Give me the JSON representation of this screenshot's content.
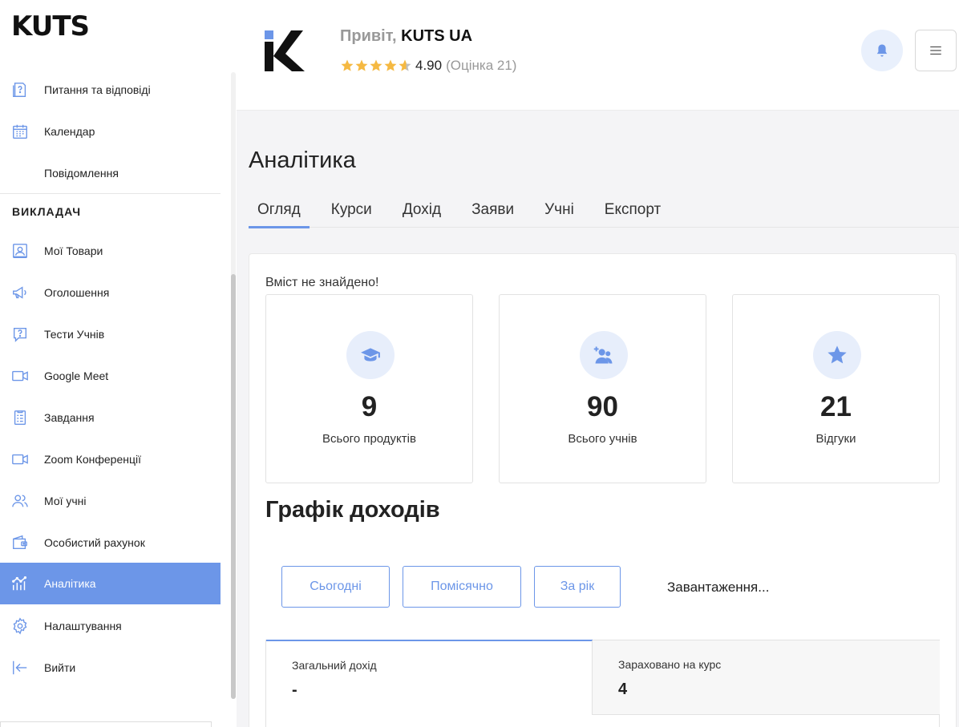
{
  "app": {
    "logo_text": "KUTS"
  },
  "sidebar": {
    "top_items": [
      {
        "label": "Питання та відповіді",
        "icon": "qa-book-icon"
      },
      {
        "label": "Календар",
        "icon": "calendar-icon"
      },
      {
        "label": "Повідомлення",
        "icon": ""
      }
    ],
    "section_title": "ВИКЛАДАЧ",
    "items": [
      {
        "label": "Мої Товари",
        "icon": "product-icon"
      },
      {
        "label": "Оголошення",
        "icon": "megaphone-icon"
      },
      {
        "label": "Тести Учнів",
        "icon": "quiz-icon"
      },
      {
        "label": "Google Meet",
        "icon": "video-icon"
      },
      {
        "label": "Завдання",
        "icon": "assignment-icon"
      },
      {
        "label": "Zoom Конференції",
        "icon": "video-icon"
      },
      {
        "label": "Мої учні",
        "icon": "users-icon"
      },
      {
        "label": "Особистий рахунок",
        "icon": "wallet-icon"
      },
      {
        "label": "Аналітика",
        "icon": "analytics-icon",
        "active": true
      },
      {
        "label": "Налаштування",
        "icon": "gear-icon"
      },
      {
        "label": "Вийти",
        "icon": "logout-icon"
      }
    ]
  },
  "header": {
    "greeting": "Привіт,",
    "user_name": "KUTS UA",
    "rating_value": "4.90",
    "rating_count": "(Оцінка 21)",
    "rating_stars": 4.9,
    "accent_color": "#6c96e8",
    "star_color": "#f5b942"
  },
  "main": {
    "title": "Аналітика",
    "tabs": [
      {
        "label": "Огляд",
        "active": true
      },
      {
        "label": "Курси"
      },
      {
        "label": "Дохід"
      },
      {
        "label": "Заяви"
      },
      {
        "label": "Учні"
      },
      {
        "label": "Експорт"
      }
    ],
    "empty_message": "Вміст не знайдено!",
    "stats": [
      {
        "value": "9",
        "label": "Всього продуктів",
        "icon": "graduation-cap-icon"
      },
      {
        "value": "90",
        "label": "Всього учнів",
        "icon": "add-user-icon"
      },
      {
        "value": "21",
        "label": "Відгуки",
        "icon": "star-icon"
      }
    ],
    "income": {
      "title": "Графік доходів",
      "ranges": [
        "Сьогодні",
        "Помісячно",
        "За рік"
      ],
      "loading_text": "Завантаження...",
      "summary": [
        {
          "label": "Загальний дохід",
          "value": "-"
        },
        {
          "label": "Зараховано на курс",
          "value": "4"
        }
      ]
    }
  }
}
